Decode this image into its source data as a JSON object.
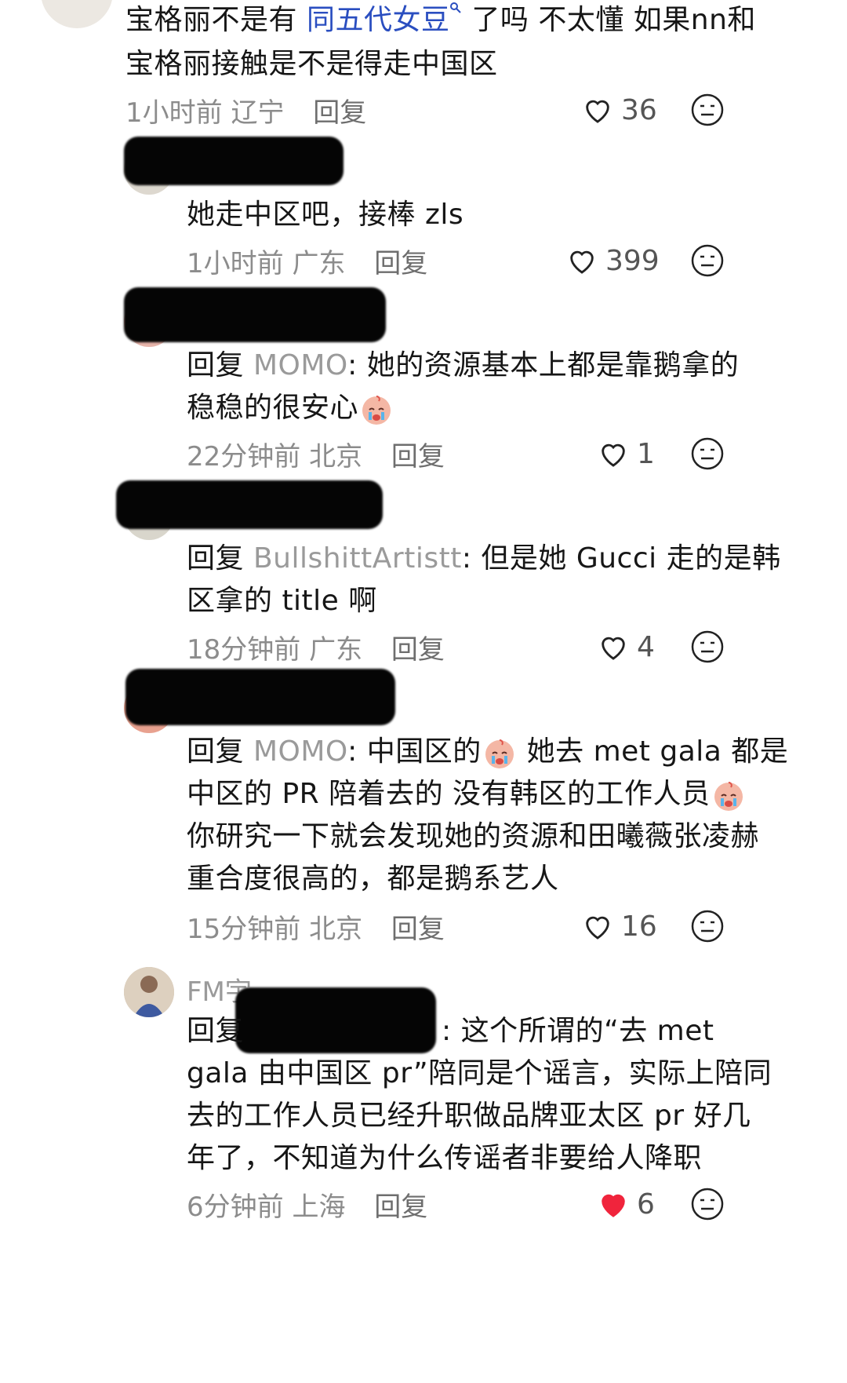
{
  "comments": [
    {
      "text_a": "宝格丽不是有 ",
      "link": "同五代女豆",
      "text_b": " 了吗 不太懂 如果nn和",
      "line2": "宝格丽接触是不是得走中国区",
      "time": "1小时前",
      "location": "辽宁",
      "reply": "回复",
      "likes": "36"
    },
    {
      "text": "她走中区吧，接棒 zls",
      "time": "1小时前",
      "location": "广东",
      "reply": "回复",
      "likes": "399"
    },
    {
      "prefix": "回复 ",
      "mention": "MOMO",
      "text": ": 她的资源基本上都是靠鹅拿的",
      "line2": "稳稳的很安心",
      "time": "22分钟前",
      "location": "北京",
      "reply": "回复",
      "likes": "1"
    },
    {
      "prefix": "回复 ",
      "mention": "BullshittArtistt",
      "text": ": 但是她 Gucci 走的是韩",
      "line2": "区拿的 title 啊",
      "time": "18分钟前",
      "location": "广东",
      "reply": "回复",
      "likes": "4"
    },
    {
      "prefix": "回复 ",
      "mention": "MOMO",
      "text": ": 中国区的",
      "text_b": " 她去 met gala 都是",
      "line2": "中区的 PR 陪着去的 没有韩区的工作人员",
      "line3": "你研究一下就会发现她的资源和田曦薇张凌赫",
      "line4": "重合度很高的，都是鹅系艺人",
      "time": "15分钟前",
      "location": "北京",
      "reply": "回复",
      "likes": "16"
    },
    {
      "name": "FM宇",
      "prefix": "回复",
      "text": ": 这个所谓的“去 met",
      "line2": "gala 由中国区 pr”陪同是个谣言，实际上陪同",
      "line3": "去的工作人员已经升职做品牌亚太区 pr 好几",
      "line4": "年了，不知道为什么传谣者非要给人降职",
      "time": "6分钟前",
      "location": "上海",
      "reply": "回复",
      "likes": "6"
    }
  ],
  "colors": {
    "liked": "#f0243c",
    "link": "#2a4ec0"
  }
}
